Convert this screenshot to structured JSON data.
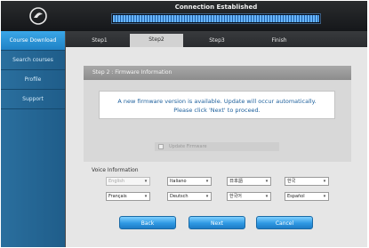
{
  "header": {
    "title": "Connection Established",
    "progress": 1.0
  },
  "sidebar": {
    "items": [
      {
        "label": "Course Download"
      },
      {
        "label": "Search courses"
      },
      {
        "label": "Profile"
      },
      {
        "label": "Support"
      }
    ]
  },
  "tabs": [
    {
      "label": "Step1"
    },
    {
      "label": "Step2"
    },
    {
      "label": "Step3"
    },
    {
      "label": "Finish"
    }
  ],
  "panel": {
    "heading": "Step 2 : Firmware Information",
    "message_line1": "A new firmware version is available.  Update will occur automatically.",
    "message_line2": "Please click 'Next' to proceed.",
    "update_checkbox_label": "Update Firmware"
  },
  "voice": {
    "title": "Voice Information",
    "languages": [
      "English",
      "Italiano",
      "日本語",
      "한국",
      "Français",
      "Deutsch",
      "한국어",
      "Español"
    ]
  },
  "buttons": {
    "back": "Back",
    "next": "Next",
    "cancel": "Cancel"
  },
  "colors": {
    "accent": "#2f99e3",
    "sidebar": "#2a6f9e",
    "header": "#15171a"
  }
}
